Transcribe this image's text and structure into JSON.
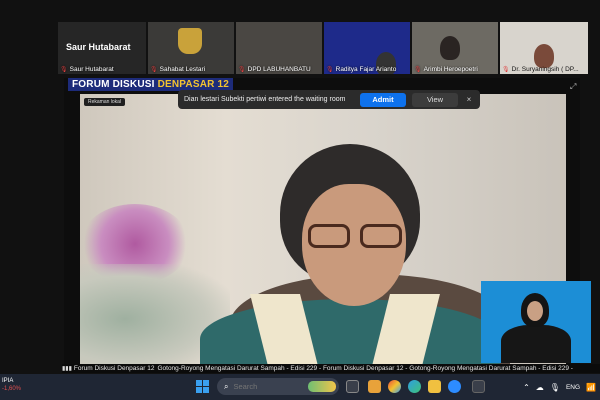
{
  "participants": [
    {
      "name": "Saur Hutabarat",
      "display_name": "Saur Hutabarat"
    },
    {
      "name": "Sahabat Lestari"
    },
    {
      "name": "DPD LABUHANBATU"
    },
    {
      "name": "Raditya Fajar Arianto"
    },
    {
      "name": "Arimbi Heroepoetri"
    },
    {
      "name": "Dr. Suryaningsih ( DP..."
    }
  ],
  "banner": {
    "part1": "FORUM DISKUSI ",
    "part2": "DENPASAR 12"
  },
  "recording_label": "Rekaman lokal",
  "notice": {
    "message": "Dian lestari Subekti pertiwi entered the waiting room",
    "admit_label": "Admit",
    "view_label": "View",
    "close_glyph": "×"
  },
  "ticker": {
    "prefix": "Forum Diskusi Denpasar 12",
    "text": "Gotong-Royong Mengatasi Darurat Sampah - Edisi 229 - Forum Diskusi Denpasar 12 - Gotong-Royong Mengatasi Darurat Sampah - Edisi 229 -"
  },
  "taskbar": {
    "weather_label": "IPIA",
    "weather_change": "-1,60%",
    "search_placeholder": "Search",
    "language": "ENG"
  },
  "icons": {
    "mic_muted": "mic-muted-icon",
    "start": "windows-start-icon",
    "search": "search-icon"
  },
  "colors": {
    "admit": "#0e72ed",
    "banner_bg": "#1d2b7a",
    "banner_highlight": "#f4c430",
    "signer_bg": "#1c8ed6",
    "taskbar": "#1f2634"
  }
}
